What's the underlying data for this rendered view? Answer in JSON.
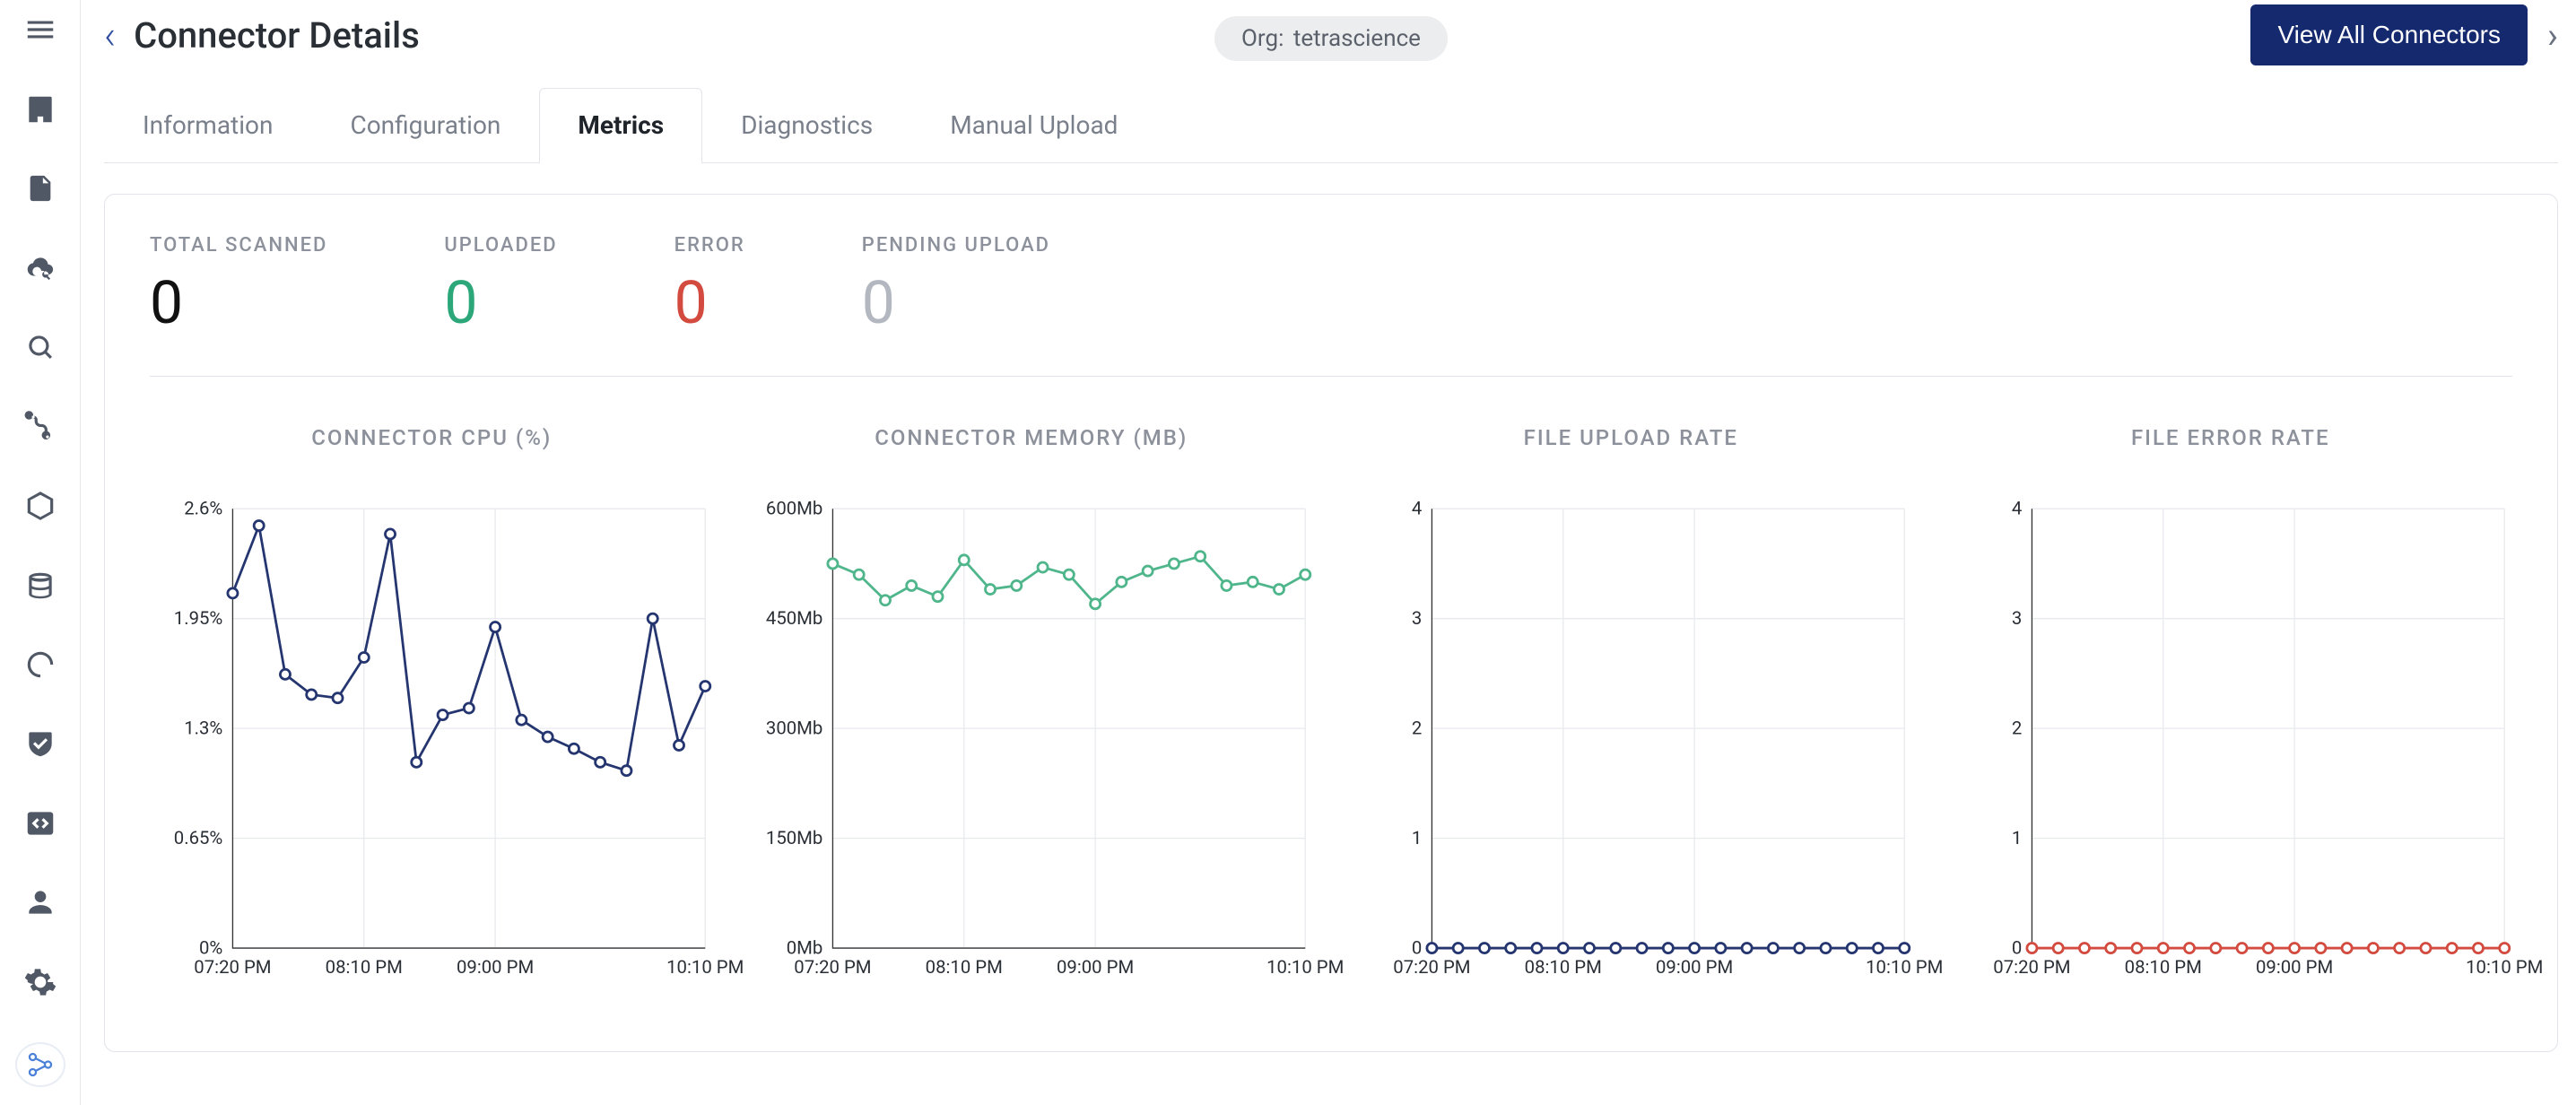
{
  "header": {
    "page_title": "Connector Details",
    "org_prefix": "Org:",
    "org_name": "tetrascience",
    "view_all_label": "View All Connectors"
  },
  "tabs": [
    {
      "id": "information",
      "label": "Information",
      "active": false
    },
    {
      "id": "configuration",
      "label": "Configuration",
      "active": false
    },
    {
      "id": "metrics",
      "label": "Metrics",
      "active": true
    },
    {
      "id": "diagnostics",
      "label": "Diagnostics",
      "active": false
    },
    {
      "id": "manual-upload",
      "label": "Manual Upload",
      "active": false
    }
  ],
  "kpis": [
    {
      "label": "TOTAL SCANNED",
      "value": "0",
      "color": "#111"
    },
    {
      "label": "UPLOADED",
      "value": "0",
      "color": "#2ba779"
    },
    {
      "label": "ERROR",
      "value": "0",
      "color": "#d34a3f"
    },
    {
      "label": "PENDING UPLOAD",
      "value": "0",
      "color": "#b3b7bf"
    }
  ],
  "chart_data": [
    {
      "type": "line",
      "title": "CONNECTOR CPU (%)",
      "x_labels": [
        "07:20 PM",
        "08:10 PM",
        "09:00 PM",
        "10:10 PM"
      ],
      "y_ticks": [
        {
          "v": 0,
          "l": "0%"
        },
        {
          "v": 0.65,
          "l": "0.65%"
        },
        {
          "v": 1.3,
          "l": "1.3%"
        },
        {
          "v": 1.95,
          "l": "1.95%"
        },
        {
          "v": 2.6,
          "l": "2.6%"
        }
      ],
      "ylim": [
        0,
        2.6
      ],
      "color": "#24356f",
      "series": [
        {
          "name": "cpu",
          "values": [
            2.1,
            2.5,
            1.62,
            1.5,
            1.48,
            1.72,
            2.45,
            1.1,
            1.38,
            1.42,
            1.9,
            1.35,
            1.25,
            1.18,
            1.1,
            1.05,
            1.95,
            1.2,
            1.55
          ]
        }
      ],
      "x_count": 19
    },
    {
      "type": "line",
      "title": "CONNECTOR MEMORY (MB)",
      "x_labels": [
        "07:20 PM",
        "08:10 PM",
        "09:00 PM",
        "10:10 PM"
      ],
      "y_ticks": [
        {
          "v": 0,
          "l": "0Mb"
        },
        {
          "v": 150,
          "l": "150Mb"
        },
        {
          "v": 300,
          "l": "300Mb"
        },
        {
          "v": 450,
          "l": "450Mb"
        },
        {
          "v": 600,
          "l": "600Mb"
        }
      ],
      "ylim": [
        0,
        600
      ],
      "color": "#4fb58b",
      "series": [
        {
          "name": "memory",
          "values": [
            525,
            510,
            475,
            495,
            480,
            530,
            490,
            495,
            520,
            510,
            470,
            500,
            515,
            525,
            535,
            495,
            500,
            490,
            510
          ]
        }
      ],
      "x_count": 19
    },
    {
      "type": "line",
      "title": "FILE UPLOAD RATE",
      "x_labels": [
        "07:20 PM",
        "08:10 PM",
        "09:00 PM",
        "10:10 PM"
      ],
      "y_ticks": [
        {
          "v": 0,
          "l": "0"
        },
        {
          "v": 1,
          "l": "1"
        },
        {
          "v": 2,
          "l": "2"
        },
        {
          "v": 3,
          "l": "3"
        },
        {
          "v": 4,
          "l": "4"
        }
      ],
      "ylim": [
        0,
        4
      ],
      "color": "#24356f",
      "series": [
        {
          "name": "upload_rate",
          "values": [
            0,
            0,
            0,
            0,
            0,
            0,
            0,
            0,
            0,
            0,
            0,
            0,
            0,
            0,
            0,
            0,
            0,
            0,
            0
          ]
        }
      ],
      "x_count": 19
    },
    {
      "type": "line",
      "title": "FILE ERROR RATE",
      "x_labels": [
        "07:20 PM",
        "08:10 PM",
        "09:00 PM",
        "10:10 PM"
      ],
      "y_ticks": [
        {
          "v": 0,
          "l": "0"
        },
        {
          "v": 1,
          "l": "1"
        },
        {
          "v": 2,
          "l": "2"
        },
        {
          "v": 3,
          "l": "3"
        },
        {
          "v": 4,
          "l": "4"
        }
      ],
      "ylim": [
        0,
        4
      ],
      "color": "#d34a3f",
      "series": [
        {
          "name": "error_rate",
          "values": [
            0,
            0,
            0,
            0,
            0,
            0,
            0,
            0,
            0,
            0,
            0,
            0,
            0,
            0,
            0,
            0,
            0,
            0,
            0
          ]
        }
      ],
      "x_count": 19
    }
  ]
}
